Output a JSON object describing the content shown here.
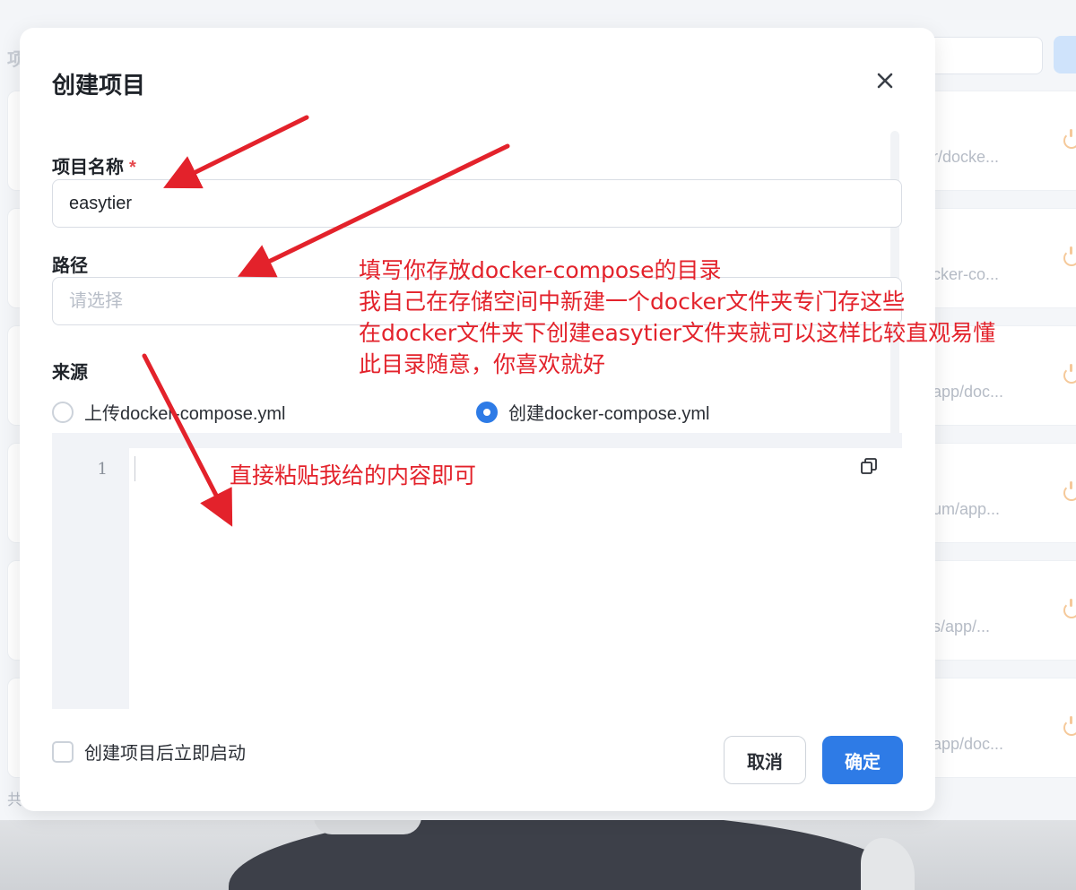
{
  "background": {
    "left_title_fragment": "项",
    "footer_fragment": "共",
    "cards": [
      {
        "path_fragment": "r/docke..."
      },
      {
        "path_fragment": "cker-co..."
      },
      {
        "path_fragment": "app/doc..."
      },
      {
        "path_fragment": "um/app..."
      },
      {
        "path_fragment": "s/app/..."
      },
      {
        "path_fragment": "app/doc..."
      }
    ]
  },
  "modal": {
    "title": "创建项目",
    "name_field": {
      "label": "项目名称",
      "required_mark": "*",
      "value": "easytier"
    },
    "path_field": {
      "label": "路径",
      "placeholder": "请选择"
    },
    "source": {
      "label": "来源",
      "options": [
        {
          "label": "上传docker-compose.yml",
          "selected": false
        },
        {
          "label": "创建docker-compose.yml",
          "selected": true
        }
      ]
    },
    "editor": {
      "line_number": "1",
      "content": ""
    },
    "autostart_checkbox": {
      "label": "创建项目后立即启动",
      "checked": false
    },
    "buttons": {
      "cancel": "取消",
      "ok": "确定"
    }
  },
  "annotations": {
    "path_note": [
      "填写你存放docker-compose的目录",
      "我自己在存储空间中新建一个docker文件夹专门存这些",
      "在docker文件夹下创建easytier文件夹就可以这样比较直观易懂",
      "此目录随意，你喜欢就好"
    ],
    "editor_note": "直接粘贴我给的内容即可",
    "color": "#e3222b"
  },
  "colors": {
    "primary": "#2e7be6",
    "required": "#e5484d",
    "annotation": "#e3222b"
  }
}
